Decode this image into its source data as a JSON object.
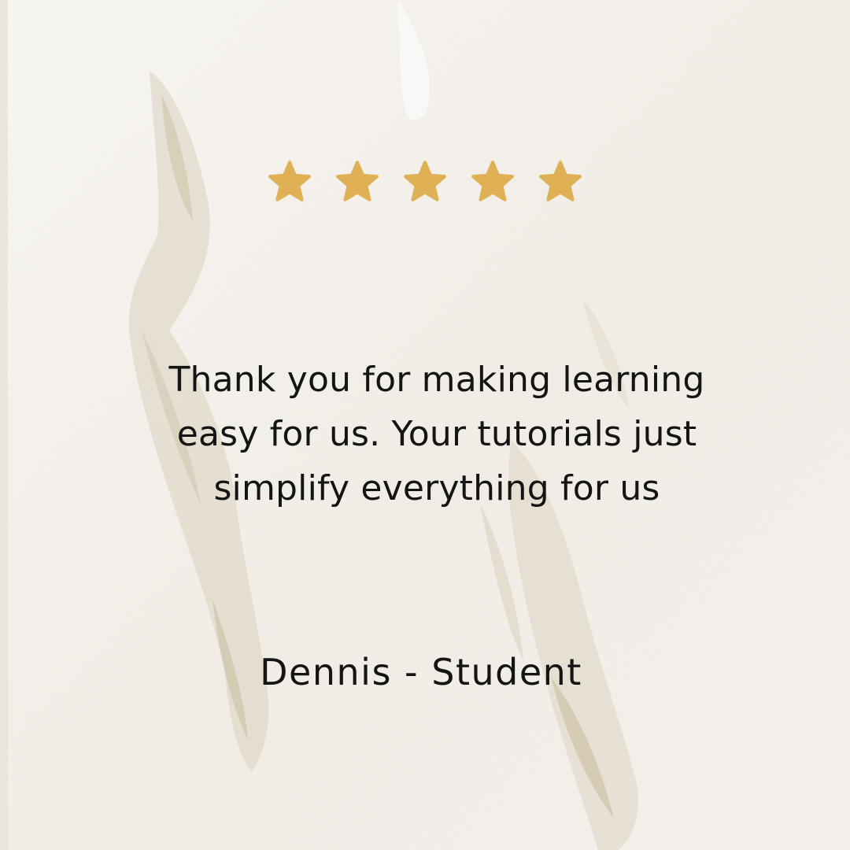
{
  "rating": {
    "value": 5,
    "max": 5,
    "star_color": "#dfb154",
    "icon": "star-icon"
  },
  "testimonial": {
    "quote_lines": [
      "Thank you for making learning",
      "easy for us. Your tutorials just",
      "simplify everything for us"
    ],
    "author": "Dennis - Student"
  },
  "colors": {
    "background": "#f6f2ed",
    "text": "#141414"
  }
}
